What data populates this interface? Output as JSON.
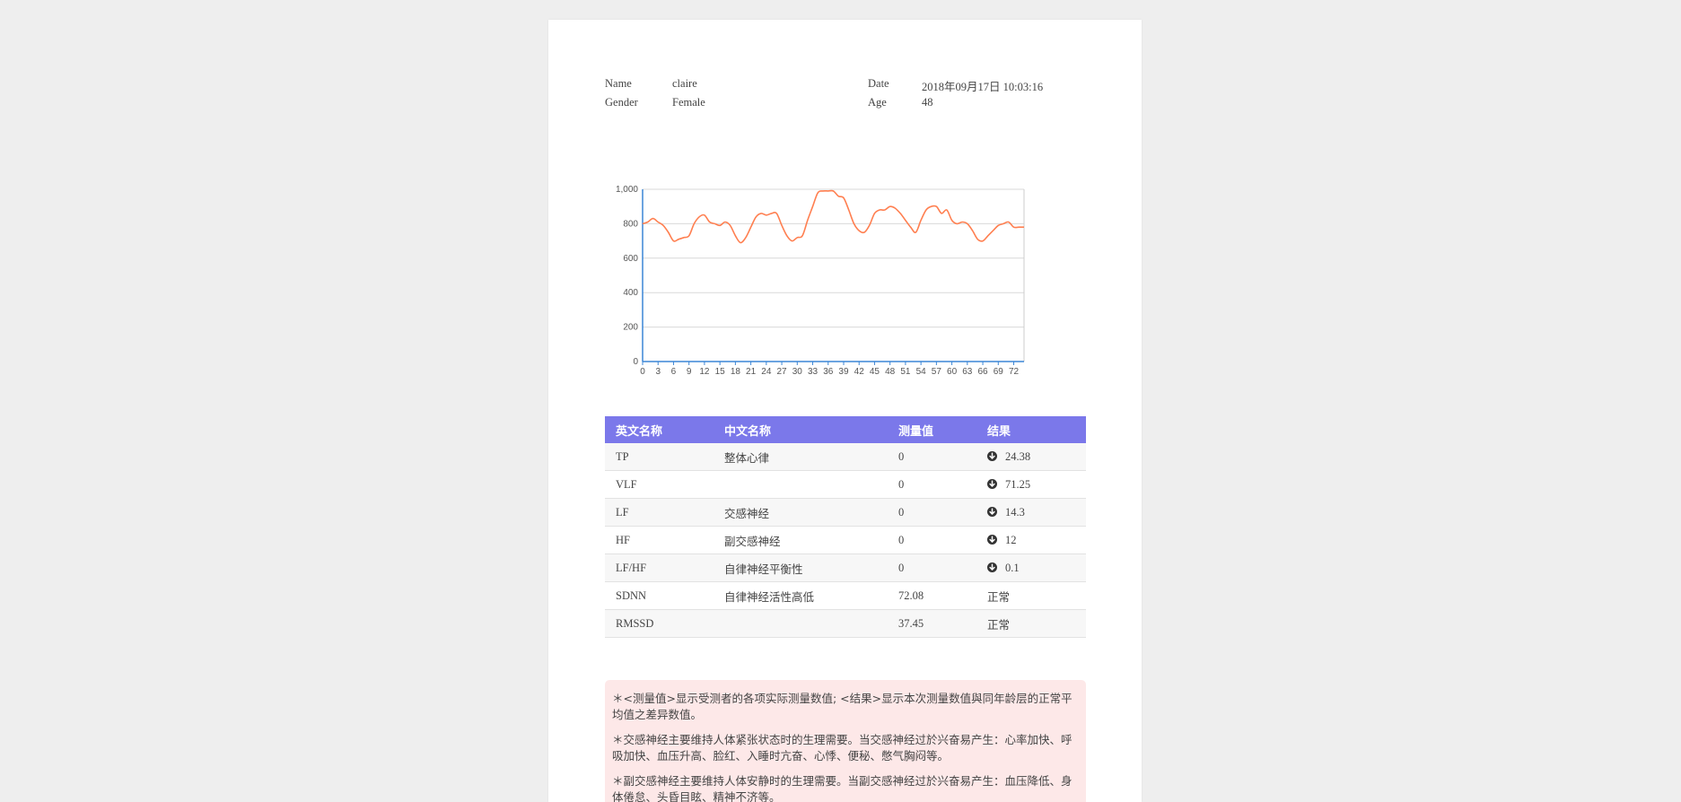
{
  "patient": {
    "name_label": "Name",
    "name_value": "claire",
    "gender_label": "Gender",
    "gender_value": "Female",
    "date_label": "Date",
    "date_value": "2018年09月17日 10:03:16",
    "age_label": "Age",
    "age_value": "48"
  },
  "colors": {
    "line": "#ff7f50",
    "axis": "#3b86d6",
    "header": "#7b78ea",
    "notes_bg": "#fde8e8"
  },
  "chart_data": {
    "type": "line",
    "x": [
      0,
      1,
      2,
      3,
      4,
      5,
      6,
      7,
      8,
      9,
      10,
      11,
      12,
      13,
      14,
      15,
      16,
      17,
      18,
      19,
      20,
      21,
      22,
      23,
      24,
      25,
      26,
      27,
      28,
      29,
      30,
      31,
      32,
      33,
      34,
      35,
      36,
      37,
      38,
      39,
      40,
      41,
      42,
      43,
      44,
      45,
      46,
      47,
      48,
      49,
      50,
      51,
      52,
      53,
      54,
      55,
      56,
      57,
      58,
      59,
      60,
      61,
      62,
      63,
      64,
      65,
      66,
      67,
      68,
      69,
      70,
      71,
      72,
      73,
      74
    ],
    "series": [
      {
        "values": [
          800,
          810,
          830,
          810,
          790,
          750,
          700,
          710,
          720,
          730,
          800,
          840,
          850,
          810,
          800,
          790,
          810,
          790,
          730,
          690,
          720,
          780,
          840,
          860,
          850,
          860,
          860,
          790,
          730,
          700,
          720,
          730,
          820,
          900,
          980,
          990,
          990,
          990,
          960,
          950,
          880,
          800,
          760,
          750,
          790,
          860,
          880,
          880,
          900,
          890,
          860,
          820,
          780,
          750,
          820,
          880,
          900,
          900,
          860,
          880,
          820,
          800,
          810,
          800,
          760,
          710,
          700,
          730,
          760,
          790,
          800,
          810,
          780,
          780,
          780
        ]
      }
    ],
    "ylim": [
      0,
      1000
    ],
    "yticks": [
      "0",
      "200",
      "400",
      "600",
      "800",
      "1,000"
    ],
    "xticks": [
      "0",
      "3",
      "6",
      "9",
      "12",
      "15",
      "18",
      "21",
      "24",
      "27",
      "30",
      "33",
      "36",
      "39",
      "42",
      "45",
      "48",
      "51",
      "54",
      "57",
      "60",
      "63",
      "66",
      "69",
      "72"
    ],
    "grid": true
  },
  "table": {
    "headers": [
      "英文名称",
      "中文名称",
      "测量值",
      "结果"
    ],
    "rows": [
      {
        "en": "TP",
        "cn": "整体心律",
        "value": "0",
        "result": "24.38",
        "result_icon": "arrow-down-circle-icon"
      },
      {
        "en": "VLF",
        "cn": "",
        "value": "0",
        "result": "71.25",
        "result_icon": "arrow-down-circle-icon"
      },
      {
        "en": "LF",
        "cn": "交感神经",
        "value": "0",
        "result": "14.3",
        "result_icon": "arrow-down-circle-icon"
      },
      {
        "en": "HF",
        "cn": "副交感神经",
        "value": "0",
        "result": "12",
        "result_icon": "arrow-down-circle-icon"
      },
      {
        "en": "LF/HF",
        "cn": "自律神经平衡性",
        "value": "0",
        "result": "0.1",
        "result_icon": "arrow-down-circle-icon"
      },
      {
        "en": "SDNN",
        "cn": "自律神经活性高低",
        "value": "72.08",
        "result": "正常"
      },
      {
        "en": "RMSSD",
        "cn": "",
        "value": "37.45",
        "result": "正常"
      }
    ]
  },
  "notes": [
    "＊<测量值>显示受测者的各项实际测量数值; <结果>显示本次测量数值與同年龄层的正常平均值之差异数值。",
    "＊交感神经主要维持人体紧张状态时的生理需要。当交感神经过於兴奋易产生：心率加快、呼吸加快、血压升高、脸红、入睡时亢奋、心悸、便秘、憋气胸闷等。",
    "＊副交感神经主要维持人体安静时的生理需要。当副交感神经过於兴奋易产生：血压降低、身体倦怠、头昏目眩、精神不济等。"
  ]
}
